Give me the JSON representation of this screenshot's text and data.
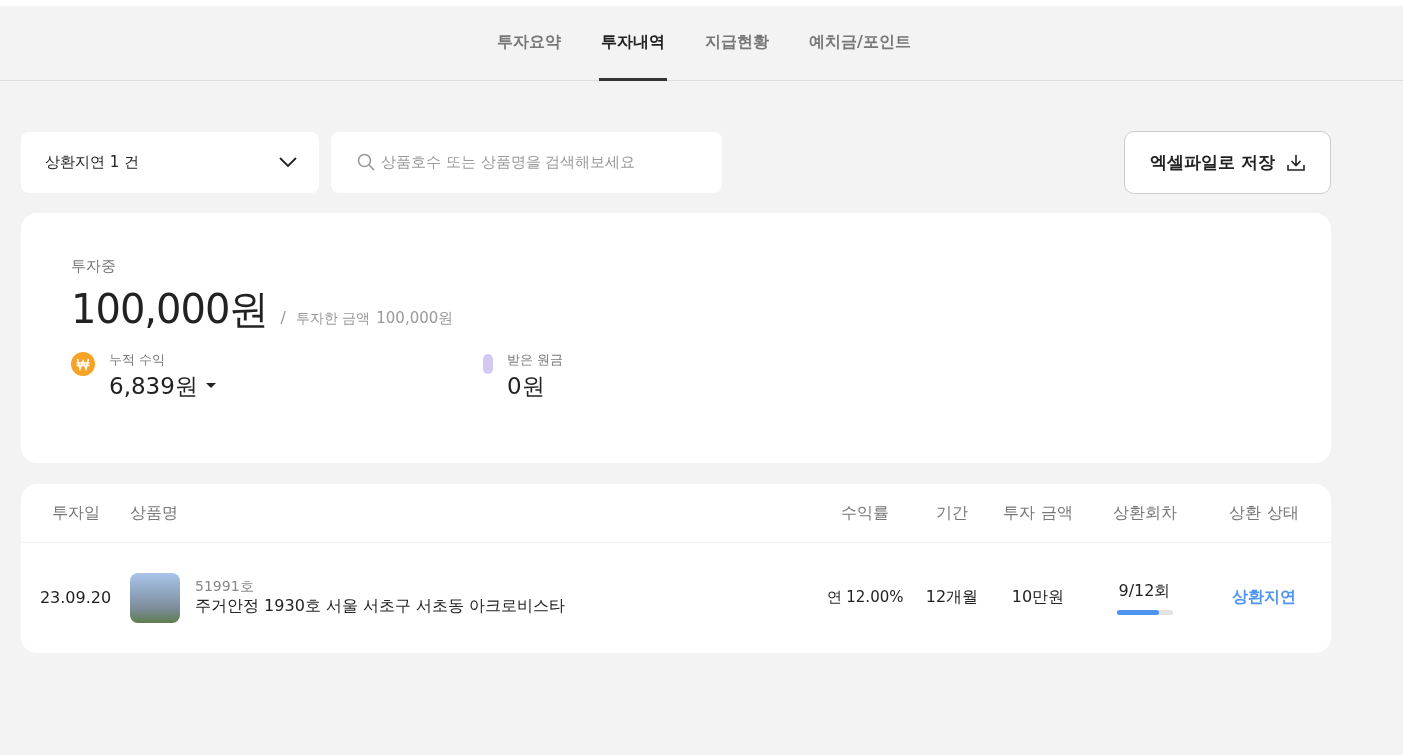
{
  "tabs": [
    {
      "label": "투자요약",
      "selected": false
    },
    {
      "label": "투자내역",
      "selected": true
    },
    {
      "label": "지급현황",
      "selected": false
    },
    {
      "label": "예치금/포인트",
      "selected": false
    }
  ],
  "filter": {
    "value": "상환지연 1 건"
  },
  "search": {
    "placeholder": "상품호수 또는 상품명을 검색해보세요"
  },
  "export_button": "엑셀파일로 저장",
  "summary": {
    "label": "투자중",
    "amount": "100,000원",
    "separator": "/",
    "invested_label": "투자한 금액",
    "invested_amount": "100,000원",
    "stats": [
      {
        "kind": "coin",
        "label": "누적 수익",
        "value": "6,839원",
        "expandable": true
      },
      {
        "kind": "pill",
        "label": "받은 원금",
        "value": "0원",
        "color": "#d4c9f3"
      }
    ]
  },
  "table": {
    "columns": [
      "투자일",
      "상품명",
      "수익률",
      "기간",
      "투자 금액",
      "상환회차",
      "상환 상태"
    ],
    "rows": [
      {
        "date": "23.09.20",
        "product_no": "51991호",
        "product_name": "주거안정 1930호 서울 서초구 서초동 아크로비스타",
        "yield": "연 12.00%",
        "period": "12개월",
        "amount": "10만원",
        "round": "9/12회",
        "level": 0.75,
        "status": "상환지연"
      }
    ]
  }
}
